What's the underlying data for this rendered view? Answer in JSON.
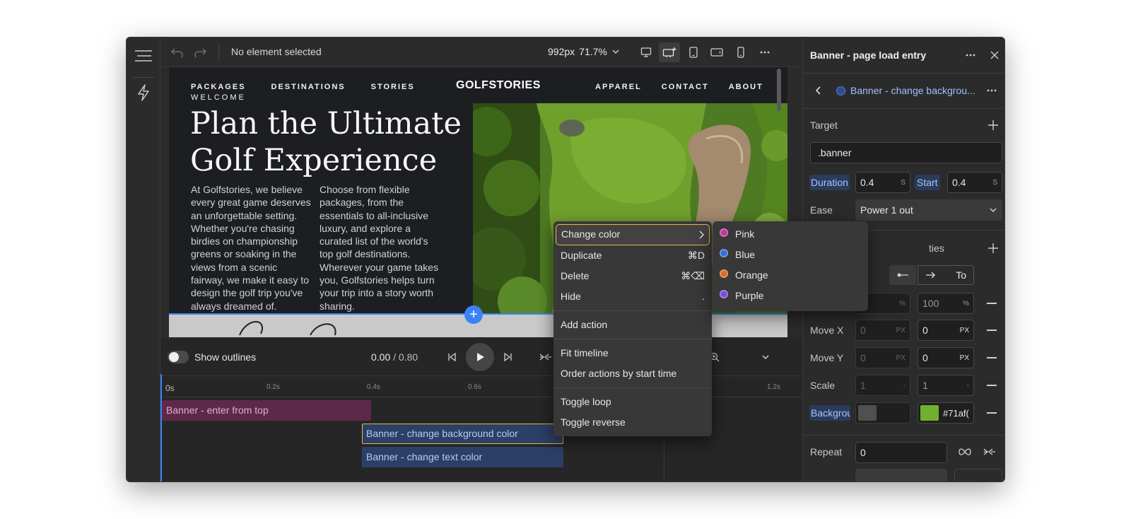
{
  "toolbar": {
    "status": "No element selected",
    "size": "992px",
    "zoom": "71.7%"
  },
  "site": {
    "nav_left": [
      "PACKAGES",
      "DESTINATIONS",
      "STORIES"
    ],
    "brand": "GOLFSTORIES",
    "nav_right": [
      "APPAREL",
      "CONTACT",
      "ABOUT"
    ],
    "eyebrow": "WELCOME",
    "headline_1": "Plan the Ultimate",
    "headline_2": "Golf Experience",
    "col1": "At Golfstories, we believe every great game deserves an unforgettable setting. Whether you're chasing birdies on championship greens or soaking in the views from a scenic fairway, we make it easy to design the golf trip you've always dreamed of.",
    "col2": "Choose from flexible packages, from the essentials to all-inclusive luxury, and explore a curated list of the world's top golf destinations. Wherever your game takes you, Golfstories helps turn your trip into a story worth sharing."
  },
  "timeline": {
    "outline_label": "Show outlines",
    "outlines_enabled": false,
    "current_time": "0.00",
    "total_time": "/ 0.80",
    "ticks": [
      "0s",
      "0.2s",
      "0.4s",
      "0.6s",
      "1.2s"
    ],
    "bars": [
      {
        "label": "Banner - enter from top"
      },
      {
        "label": "Banner - change background color"
      },
      {
        "label": "Banner - change text color"
      }
    ]
  },
  "panel": {
    "title": "Banner - page load entry",
    "action_title": "Banner - change backgrou...",
    "target_label": "Target",
    "target_value": ".banner",
    "duration_label": "Duration",
    "duration_value": "0.4",
    "duration_unit": "S",
    "start_label": "Start",
    "start_value": "0.4",
    "start_unit": "S",
    "ease_label": "Ease",
    "ease_value": "Power 1 out",
    "properties_label": "ties",
    "to_label": "To",
    "opacity_from": "",
    "opacity_from_unit": "%",
    "opacity_to": "100",
    "opacity_to_unit": "%",
    "movex_label": "Move X",
    "movex_from": "0",
    "movex_from_unit": "PX",
    "movex_to": "0",
    "movex_to_unit": "PX",
    "movey_label": "Move Y",
    "movey_from": "0",
    "movey_from_unit": "PX",
    "movey_to": "0",
    "movey_to_unit": "PX",
    "scale_label": "Scale",
    "scale_from": "1",
    "scale_from_unit": "-",
    "scale_to": "1",
    "scale_to_unit": "-",
    "bg_label": "Backgrou",
    "bg_to_hex": "#71af(",
    "bg_to_color": "#71af2e",
    "repeat_label": "Repeat",
    "repeat_value": "0"
  },
  "context_menu": {
    "change_color": "Change color",
    "duplicate": "Duplicate",
    "duplicate_shortcut": "⌘D",
    "delete": "Delete",
    "delete_shortcut": "⌘⌫",
    "hide": "Hide",
    "hide_shortcut": ".",
    "add_action": "Add action",
    "fit_timeline": "Fit timeline",
    "order_actions": "Order actions by start time",
    "toggle_loop": "Toggle loop",
    "toggle_reverse": "Toggle reverse"
  },
  "color_menu": [
    {
      "label": "Pink",
      "color": "#c0399a"
    },
    {
      "label": "Blue",
      "color": "#3a6fd6"
    },
    {
      "label": "Orange",
      "color": "#d6702a"
    },
    {
      "label": "Purple",
      "color": "#7a4fd6"
    }
  ],
  "colors": {
    "accent_blue": "#3b82f6",
    "selection_yellow": "#e8b84a",
    "bar_pink": "#5c2a48",
    "bar_blue": "#2c3f66"
  }
}
